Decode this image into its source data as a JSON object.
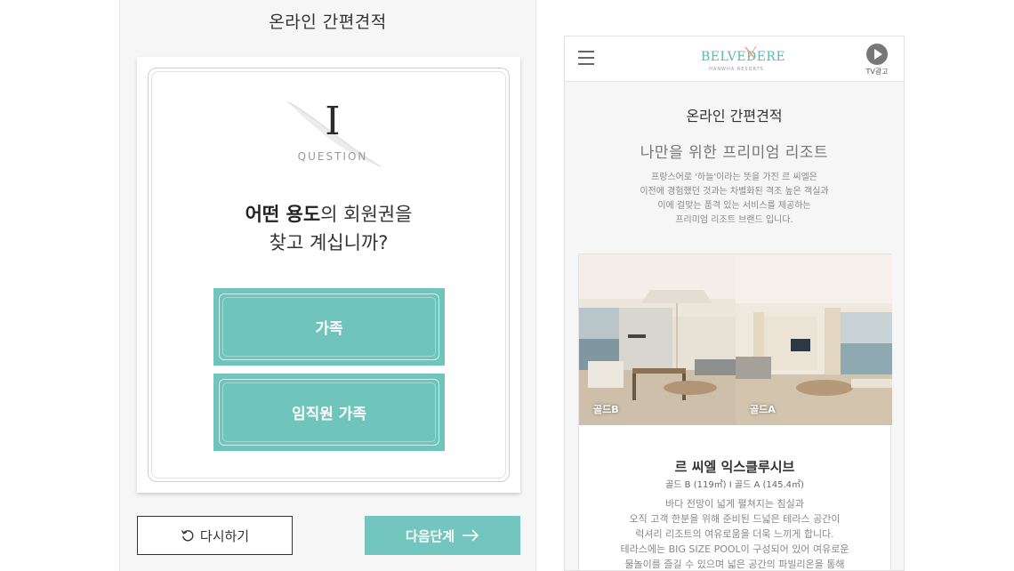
{
  "left": {
    "title": "온라인 간편견적",
    "question_number": "I",
    "question_label": "QUESTION",
    "question_bold": "어떤 용도",
    "question_rest_line1": "의 회원권을",
    "question_line2": "찾고 계십니까?",
    "options": [
      {
        "label": "가족"
      },
      {
        "label": "임직원 가족"
      }
    ],
    "reset_label": "다시하기",
    "next_label": "다음단계"
  },
  "phone": {
    "logo_text": "BELVEDERE",
    "logo_sub": "HANWHA RESORTS",
    "tv_label": "TV광고",
    "title": "온라인 간편견적",
    "subtitle": "나만을 위한 프리미엄 리조트",
    "intro": [
      "프랑스어로 '하늘'이라는 뜻을 가진 르 씨엘은",
      "이전에 경험했던 것과는 차별화된 격조 높은 객실과",
      "이에 걸맞는 품격 있는 서비스를 제공하는",
      "프리미엄 리조트 브랜드 입니다."
    ],
    "rooms": [
      {
        "label": "골드B"
      },
      {
        "label": "골드A"
      }
    ],
    "room_title": "르 씨엘 익스클루시브",
    "room_sizes": "골드 B (119㎡)  I  골드 A (145.4㎡)",
    "room_desc": [
      "바다 전망이 넓게 펼쳐지는 침실과",
      "오직 고객 한분을 위해 준비된 드넓은 테라스 공간이",
      "럭셔리 리조트의 여유로움을 더욱 느끼게 합니다.",
      "테라스에는 BIG SIZE POOL이 구성되어 있어 여유로운",
      "물놀이를 즐길 수 있으며 넓은 공간의 파빌리온을 통해"
    ]
  }
}
